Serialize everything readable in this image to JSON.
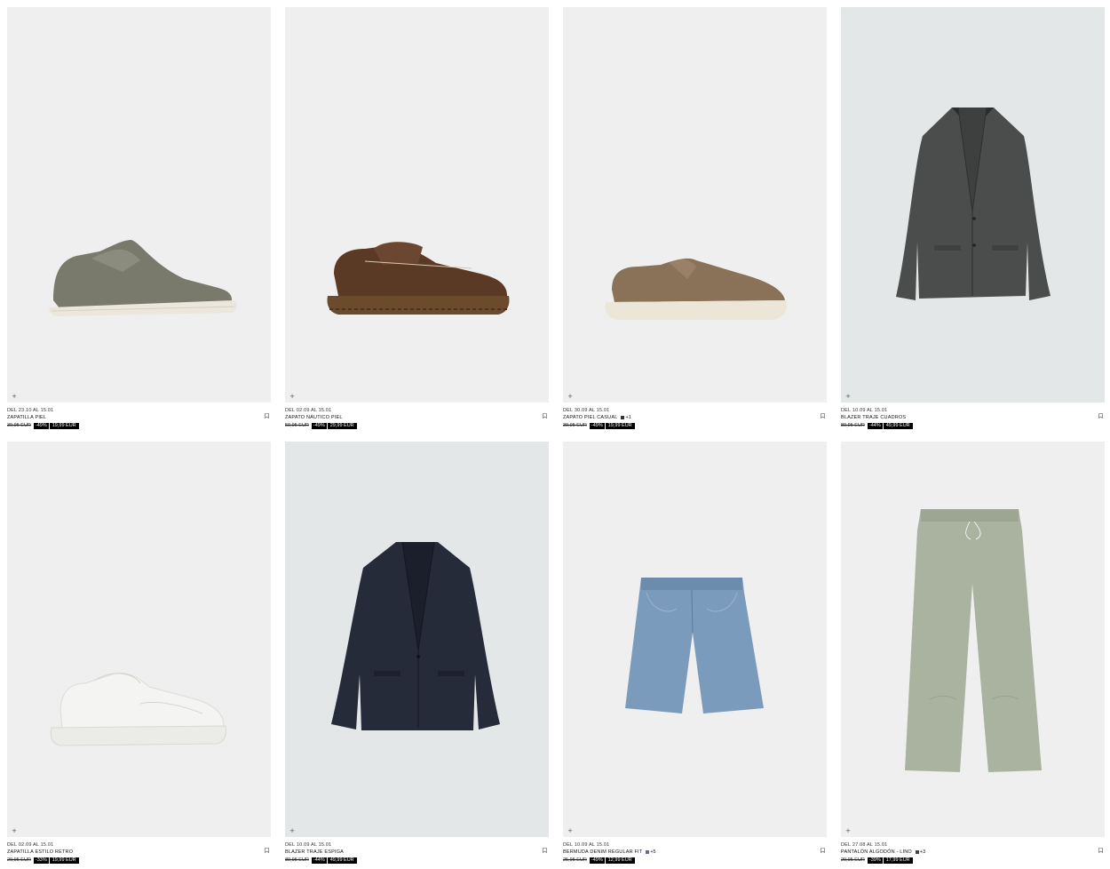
{
  "products": [
    {
      "dates": "DEL 23.10 AL 15.01",
      "name": "ZAPATILLA PIEL",
      "old_price": "39,95 EUR",
      "discount": "-49%",
      "price": "19,99 EUR",
      "more_colors": "",
      "swatch_color": "",
      "bg": "#efefef"
    },
    {
      "dates": "DEL 02.09 AL 15.01",
      "name": "ZAPATO NÁUTICO PIEL",
      "old_price": "59,95 EUR",
      "discount": "-49%",
      "price": "29,99 EUR",
      "more_colors": "",
      "swatch_color": "",
      "bg": "#efefef"
    },
    {
      "dates": "DEL 30.09 AL 15.01",
      "name": "ZAPATO PIEL CASUAL",
      "old_price": "39,95 EUR",
      "discount": "-49%",
      "price": "19,99 EUR",
      "more_colors": "+1",
      "swatch_color": "#333333",
      "bg": "#efefef"
    },
    {
      "dates": "DEL 10.09 AL 15.01",
      "name": "BLAZER TRAJE CUADROS",
      "old_price": "89,95 EUR",
      "discount": "-44%",
      "price": "49,99 EUR",
      "more_colors": "",
      "swatch_color": "",
      "bg": "#e3e7e8"
    },
    {
      "dates": "DEL 02.09 AL 15.01",
      "name": "ZAPATILLA ESTILO RETRO",
      "old_price": "29,95 EUR",
      "discount": "-33%",
      "price": "19,99 EUR",
      "more_colors": "",
      "swatch_color": "",
      "bg": "#efefef"
    },
    {
      "dates": "DEL 10.09 AL 15.01",
      "name": "BLAZER TRAJE ESPIGA",
      "old_price": "89,95 EUR",
      "discount": "-44%",
      "price": "49,99 EUR",
      "more_colors": "",
      "swatch_color": "",
      "bg": "#e3e7e8"
    },
    {
      "dates": "DEL 10.09 AL 15.01",
      "name": "BERMUDA DENIM REGULAR FIT",
      "old_price": "25,95 EUR",
      "discount": "-49%",
      "price": "12,99 EUR",
      "more_colors": "+5",
      "swatch_color": "#5a6f8c",
      "bg": "#efefef"
    },
    {
      "dates": "DEL 27.08 AL 15.01",
      "name": "PANTALÓN ALGODÓN - LINO",
      "old_price": "29,95 EUR",
      "discount": "-39%",
      "price": "17,99 EUR",
      "more_colors": "+3",
      "swatch_color": "#444444",
      "bg": "#efefef"
    }
  ],
  "icons": {
    "expand": "plus-icon",
    "save": "bookmark-icon"
  }
}
